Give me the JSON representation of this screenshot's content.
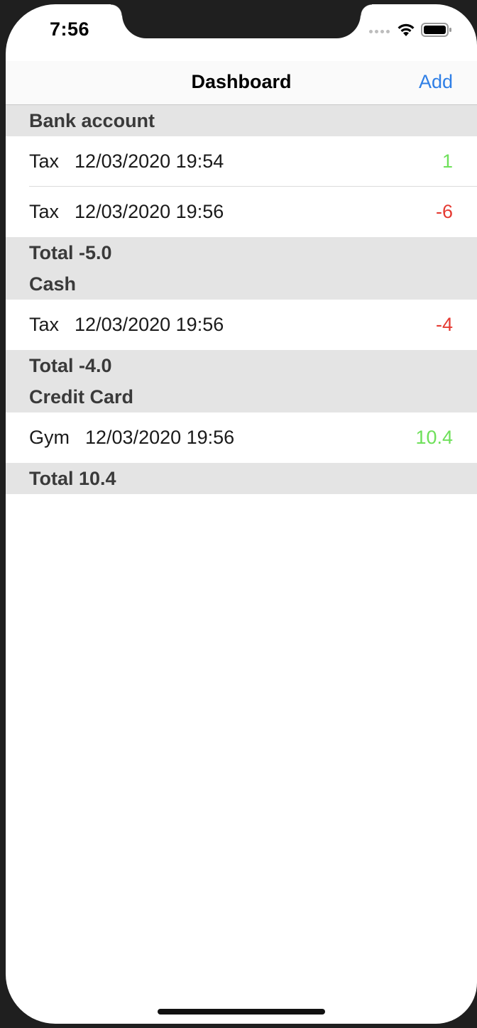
{
  "status_bar": {
    "time": "7:56",
    "icons": [
      "cellular-signal-icon",
      "wifi-icon",
      "battery-icon"
    ]
  },
  "nav": {
    "title": "Dashboard",
    "add_label": "Add"
  },
  "colors": {
    "accent": "#2f7fe6",
    "positive": "#6ee05a",
    "negative": "#e53a32",
    "section_bg": "#e4e4e4"
  },
  "sections": [
    {
      "header": "Bank account",
      "rows": [
        {
          "name": "Tax",
          "date": "12/03/2020 19:54",
          "amount": "1",
          "sign": "pos"
        },
        {
          "name": "Tax",
          "date": "12/03/2020 19:56",
          "amount": "-6",
          "sign": "neg"
        }
      ],
      "total": "Total -5.0"
    },
    {
      "header": "Cash",
      "rows": [
        {
          "name": "Tax",
          "date": "12/03/2020 19:56",
          "amount": "-4",
          "sign": "neg"
        }
      ],
      "total": "Total -4.0"
    },
    {
      "header": "Credit Card",
      "rows": [
        {
          "name": "Gym",
          "date": "12/03/2020 19:56",
          "amount": "10.4",
          "sign": "pos"
        }
      ],
      "total": "Total 10.4"
    }
  ]
}
